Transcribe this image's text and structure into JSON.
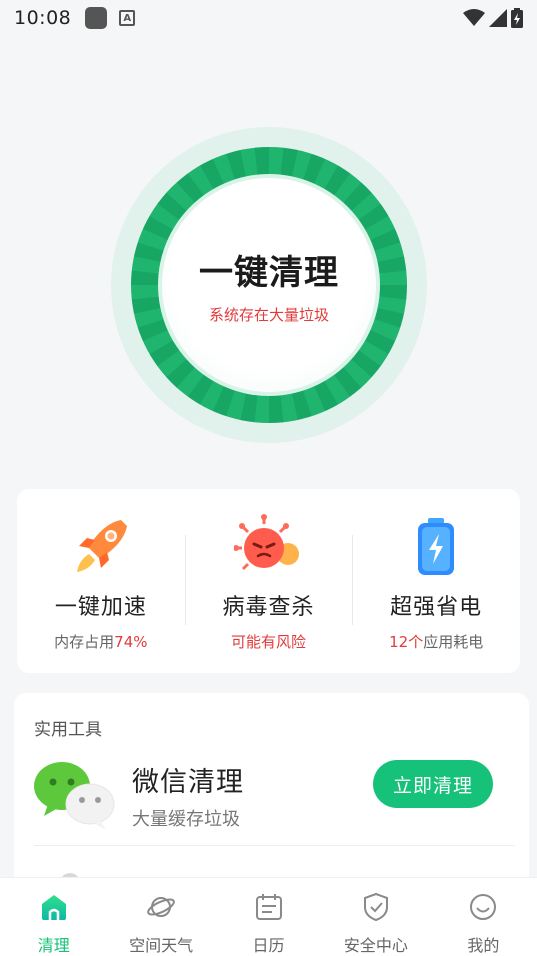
{
  "status_bar": {
    "time": "10:08",
    "icons": [
      "app-notification-icon",
      "keyboard-a-icon",
      "wifi-icon",
      "signal-icon",
      "battery-charging-icon"
    ]
  },
  "clean": {
    "title": "一键清理",
    "subtitle": "系统存在大量垃圾"
  },
  "features": [
    {
      "icon": "rocket-icon",
      "title": "一键加速",
      "sub_prefix": "内存占用",
      "sub_highlight": "74%",
      "sub_suffix": ""
    },
    {
      "icon": "virus-icon",
      "title": "病毒查杀",
      "sub_prefix": "",
      "sub_highlight": "可能有风险",
      "sub_suffix": ""
    },
    {
      "icon": "battery-icon",
      "title": "超强省电",
      "sub_prefix": "",
      "sub_highlight": "12个",
      "sub_suffix": "应用耗电"
    }
  ],
  "tools": {
    "title": "实用工具",
    "items": [
      {
        "icon": "wechat-icon",
        "name": "微信清理",
        "desc": "大量缓存垃圾",
        "button": "立即清理"
      }
    ]
  },
  "nav": {
    "items": [
      {
        "icon": "home-icon",
        "label": "清理",
        "active": true
      },
      {
        "icon": "planet-icon",
        "label": "空间天气",
        "active": false
      },
      {
        "icon": "calendar-icon",
        "label": "日历",
        "active": false
      },
      {
        "icon": "shield-check-icon",
        "label": "安全中心",
        "active": false
      },
      {
        "icon": "smile-icon",
        "label": "我的",
        "active": false
      }
    ]
  },
  "colors": {
    "accent": "#16c27a",
    "ring_green": "#1fb56f",
    "alert_red": "#e23b3b",
    "background": "#f5f6f8"
  }
}
